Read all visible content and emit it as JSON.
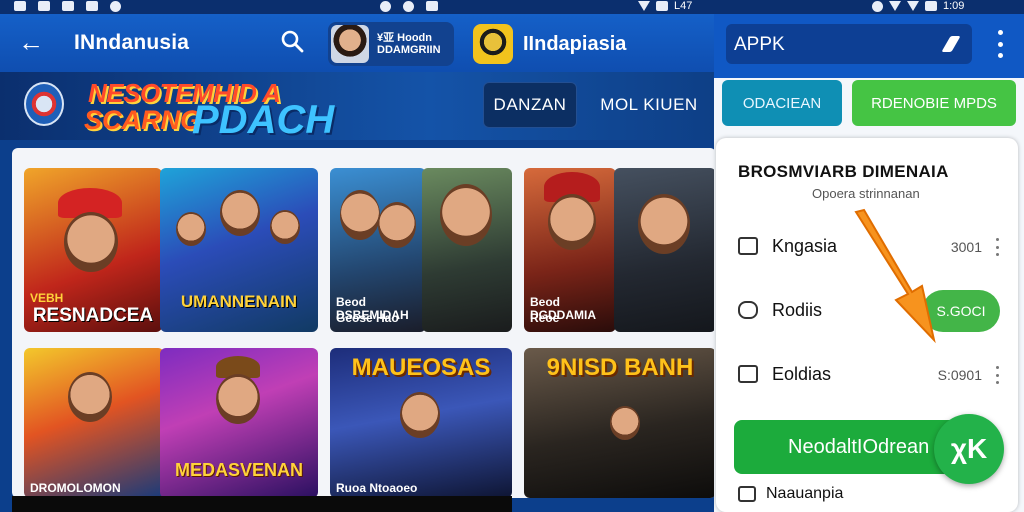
{
  "statusbar": {
    "time_left": "L47",
    "time_right": "1:09"
  },
  "appbar": {
    "title": "INndanusia",
    "chip1_text": "¥亚 Hoodn\nDDAMGRIIN",
    "chip2_text": "IIndapiasia"
  },
  "banner": {
    "line1": "NESOTEMHID A",
    "line2a": "SCARNG",
    "line2b": "PDACH",
    "button1": "DANZAN",
    "button2": "MOL KIUEN"
  },
  "games": [
    {
      "caption": "RESNADCEA",
      "tag": "VEBH"
    },
    {
      "caption": "UMANNENAIN"
    },
    {
      "caption": "Beod  DSBEMIDAH",
      "tag": "Geose  Hao"
    },
    {
      "caption": "Beod  DGDDAMIA",
      "tag": "Reoe"
    },
    {
      "caption": "DROMOLOMON"
    },
    {
      "caption": "MEDASVENAN"
    },
    {
      "caption": "MAUEOSAS",
      "tag": "Ruoa  Ntoaoeo"
    },
    {
      "caption": "9NISD BANH"
    }
  ],
  "side": {
    "input_value": "APPK",
    "cancel_label": "ODACIEAN",
    "confirm_label": "RDENOBIE MPDS",
    "panel_title": "BROSMVIARB DIMENAIA",
    "panel_subtitle": "Opoera strinnanan",
    "rows": [
      {
        "label": "Kngasia",
        "value": "3001"
      },
      {
        "label": "Rodiis",
        "value": ""
      },
      {
        "label": "Eoldias",
        "value": "S:0901"
      }
    ],
    "pill_label": "S.GOCI",
    "action_label": "NeodaltIOdrean",
    "fab_label": "χK",
    "last_row_label": "Naauanpia"
  },
  "colors": {
    "brand_blue": "#1058c4",
    "green": "#23b24a",
    "arrow_orange": "#f7931e"
  }
}
